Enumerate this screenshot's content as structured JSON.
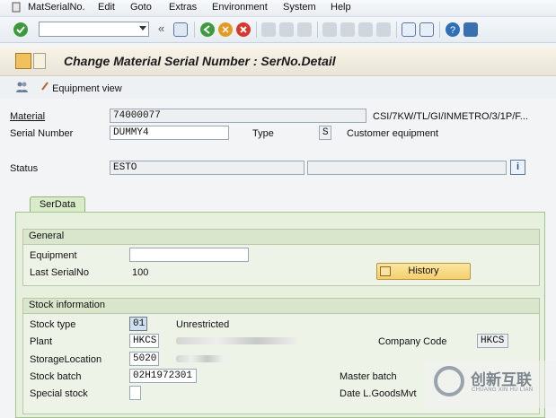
{
  "menu": [
    "MatSerialNo.",
    "Edit",
    "Goto",
    "Extras",
    "Environment",
    "System",
    "Help"
  ],
  "toolbar": {
    "command_value": ""
  },
  "title": "Change Material Serial Number : SerNo.Detail",
  "app_toolbar": {
    "equipment_view_label": "Equipment view"
  },
  "header": {
    "material_label": "Material",
    "material_value": "74000077",
    "material_desc": "CSI/7KW/TL/GI/INMETRO/3/1P/F...",
    "serial_label": "Serial Number",
    "serial_value": "DUMMY4",
    "type_label": "Type",
    "type_value": "S",
    "type_desc": "Customer equipment",
    "status_label": "Status",
    "status_value": "ESTO"
  },
  "tabs": [
    {
      "label": "SerData"
    }
  ],
  "general": {
    "title": "General",
    "equipment_label": "Equipment",
    "equipment_value": "",
    "last_serial_label": "Last SerialNo",
    "last_serial_value": "100",
    "history_button": "History"
  },
  "stock": {
    "title": "Stock information",
    "stock_type_label": "Stock type",
    "stock_type_value": "01",
    "stock_type_desc": "Unrestricted",
    "plant_label": "Plant",
    "plant_value": "HKCS",
    "company_code_label": "Company Code",
    "company_code_value": "HKCS",
    "storage_label": "StorageLocation",
    "storage_value": "5020",
    "batch_label": "Stock batch",
    "batch_value": "02H1972301",
    "master_batch_label": "Master batch",
    "special_stock_label": "Special stock",
    "date_label": "Date L.GoodsMvt"
  },
  "watermark": {
    "text": "创新互联",
    "sub": "CHUANG XIN HU LIAN"
  },
  "colors": {
    "accent_green": "#d9ebc8",
    "title_bg": "#f3eee1",
    "history_button": "#f4cf6e"
  }
}
